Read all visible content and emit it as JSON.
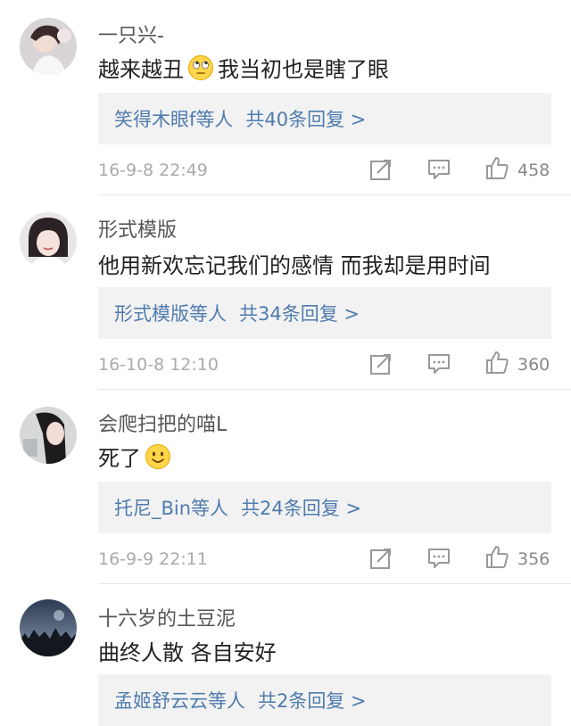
{
  "comments": [
    {
      "username": "一只兴-",
      "text_before": "越来越丑",
      "emoji": "rolling-eyes",
      "text_after": "我当初也是瞎了眼",
      "reply_names": "笑得木眼f等人",
      "reply_count": "共40条回复 >",
      "time": "16-9-8 22:49",
      "likes": "458"
    },
    {
      "username": "形式模版",
      "text_before": "他用新欢忘记我们的感情 而我却是用时间",
      "emoji": "",
      "text_after": "",
      "reply_names": "形式模版等人",
      "reply_count": "共34条回复 >",
      "time": "16-10-8 12:10",
      "likes": "360"
    },
    {
      "username": "会爬扫把的喵L",
      "text_before": "死了",
      "emoji": "smile",
      "text_after": "",
      "reply_names": "托尼_Bin等人",
      "reply_count": "共24条回复 >",
      "time": "16-9-9 22:11",
      "likes": "356"
    },
    {
      "username": "十六岁的土豆泥",
      "text_before": "曲终人散 各自安好",
      "emoji": "",
      "text_after": "",
      "reply_names": "孟姬舒云云等人",
      "reply_count": "共2条回复 >",
      "time": "",
      "likes": ""
    }
  ],
  "icons": {
    "repost": "repost-icon",
    "comment": "comment-icon",
    "like": "thumbs-up-icon"
  },
  "colors": {
    "link": "#4f7cae",
    "reply_bg": "#f2f2f2",
    "meta": "#aaaaaa"
  }
}
